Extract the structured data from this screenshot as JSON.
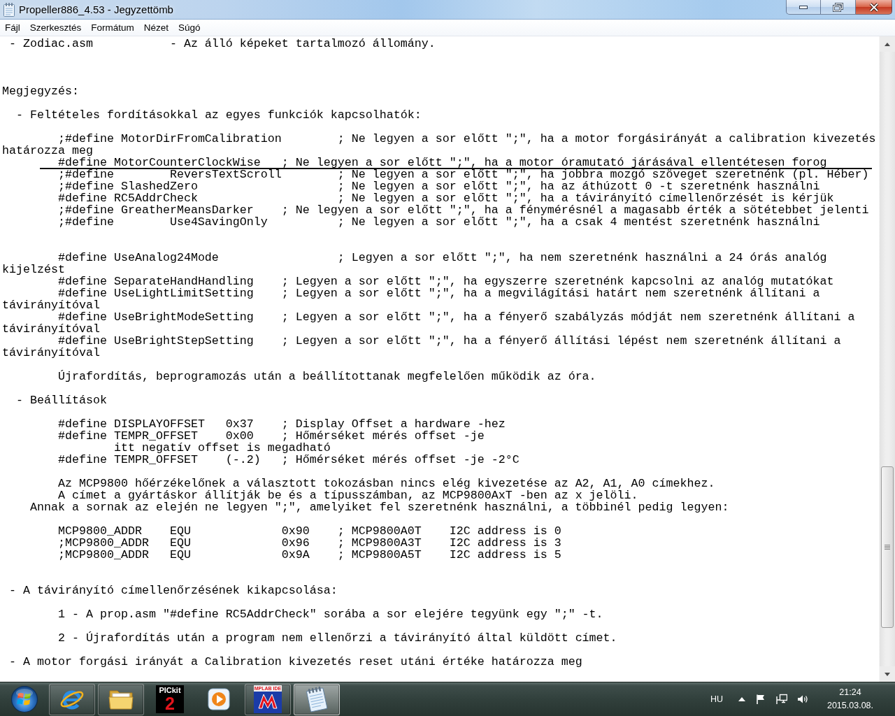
{
  "window": {
    "title": "Propeller886_4.53 - Jegyzettömb"
  },
  "menu": [
    {
      "label": "Fájl"
    },
    {
      "label": "Szerkesztés"
    },
    {
      "label": "Formátum"
    },
    {
      "label": "Nézet"
    },
    {
      "label": "Súgó"
    }
  ],
  "document": {
    "lines": [
      {
        "kind": "text",
        "text": " - Zodiac.asm\t\t- Az álló képeket tartalmozó állomány.",
        "underlined": false
      },
      {
        "kind": "blank"
      },
      {
        "kind": "blank"
      },
      {
        "kind": "blank"
      },
      {
        "kind": "text",
        "text": "Megjegyzés:",
        "underlined": false
      },
      {
        "kind": "blank"
      },
      {
        "kind": "text",
        "text": "  - Feltételes fordításokkal az egyes funkciók kapcsolhatók:",
        "underlined": false
      },
      {
        "kind": "blank"
      },
      {
        "kind": "text",
        "text": "\t;#define MotorDirFromCalibration\t; Ne legyen a sor előtt \";\", ha a motor forgásirányát a calibration kivezetés határozza meg",
        "underlined": false
      },
      {
        "kind": "text",
        "text": "\t#define MotorCounterClockWise\t; Ne legyen a sor előtt \";\", ha a motor óramutató járásával ellentétesen forog",
        "underlined": true
      },
      {
        "kind": "text",
        "text": "\t;#define\tReversTextScroll\t; Ne legyen a sor előtt \";\", ha jobbra mozgó szöveget szeretnénk (pl. Héber)",
        "underlined": false
      },
      {
        "kind": "text",
        "text": "\t;#define SlashedZero\t\t\t; Ne legyen a sor előtt \";\", ha az áthúzott 0 -t szeretnénk használni",
        "underlined": false
      },
      {
        "kind": "text",
        "text": "\t#define RC5AddrCheck\t\t\t; Ne legyen a sor előtt \";\", ha a távirányító címellenőrzését is kérjük",
        "underlined": false
      },
      {
        "kind": "text",
        "text": "\t;#define GreatherMeansDarker\t; Ne legyen a sor előtt \";\", ha a fénymérésnél a magasabb érték a sötétebbet jelenti",
        "underlined": false
      },
      {
        "kind": "text",
        "text": "\t;#define\tUse4SavingOnly\t\t; Ne legyen a sor előtt \";\", ha a csak 4 mentést szeretnénk használni",
        "underlined": false
      },
      {
        "kind": "blank"
      },
      {
        "kind": "blank"
      },
      {
        "kind": "text",
        "text": "\t#define UseAnalog24Mode\t\t\t; Legyen a sor előtt \";\", ha nem szeretnénk használni a 24 órás analóg kijelzést",
        "underlined": false
      },
      {
        "kind": "text",
        "text": "\t#define SeparateHandHandling\t; Legyen a sor előtt \";\", ha egyszerre szeretnénk kapcsolni az analóg mutatókat",
        "underlined": false
      },
      {
        "kind": "text",
        "text": "\t#define UseLightLimitSetting\t; Legyen a sor előtt \";\", ha a megvilágítási határt nem szeretnénk állítani a távirányítóval",
        "underlined": false
      },
      {
        "kind": "text",
        "text": "\t#define UseBrightModeSetting\t; Legyen a sor előtt \";\", ha a fényerő szabályzás módját nem szeretnénk állítani a távirányítóval",
        "underlined": false
      },
      {
        "kind": "text",
        "text": "\t#define UseBrightStepSetting\t; Legyen a sor előtt \";\", ha a fényerő állítási lépést nem szeretnénk állítani a távirányítóval",
        "underlined": false
      },
      {
        "kind": "blank"
      },
      {
        "kind": "text",
        "text": "\tÚjrafordítás, beprogramozás után a beállítottanak megfelelően működik az óra.",
        "underlined": false
      },
      {
        "kind": "blank"
      },
      {
        "kind": "text",
        "text": "  - Beállítások",
        "underlined": false
      },
      {
        "kind": "blank"
      },
      {
        "kind": "text",
        "text": "\t#define DISPLAYOFFSET\t0x37\t; Display Offset a hardware -hez",
        "underlined": false
      },
      {
        "kind": "text",
        "text": "\t#define TEMPR_OFFSET\t0x00\t; Hőmérséket mérés offset -je",
        "underlined": false
      },
      {
        "kind": "text",
        "text": "\t\titt negatív offset is megadható",
        "underlined": false
      },
      {
        "kind": "text",
        "text": "\t#define TEMPR_OFFSET\t(-.2)\t; Hőmérséket mérés offset -je -2°C",
        "underlined": false
      },
      {
        "kind": "blank"
      },
      {
        "kind": "text",
        "text": "\tAz MCP9800 hőérzékelőnek a választott tokozásban nincs elég kivezetése az A2, A1, A0 címekhez.",
        "underlined": false
      },
      {
        "kind": "text",
        "text": "\tA címet a gyártáskor állítják be és a típusszámban, az MCP9800AxT -ben az x jelöli.",
        "underlined": false
      },
      {
        "kind": "text",
        "text": "    Annak a sornak az elején ne legyen \";\", amelyiket fel szeretnénk használni, a többinél pedig legyen:",
        "underlined": false
      },
      {
        "kind": "blank"
      },
      {
        "kind": "text",
        "text": "\tMCP9800_ADDR\tEQU\t\t0x90\t; MCP9800A0T\tI2C address is 0",
        "underlined": false
      },
      {
        "kind": "text",
        "text": "\t;MCP9800_ADDR\tEQU\t\t0x96\t; MCP9800A3T\tI2C address is 3",
        "underlined": false
      },
      {
        "kind": "text",
        "text": "\t;MCP9800_ADDR\tEQU\t\t0x9A\t; MCP9800A5T\tI2C address is 5",
        "underlined": false
      },
      {
        "kind": "blank"
      },
      {
        "kind": "blank"
      },
      {
        "kind": "text",
        "text": " - A távirányító címellenőrzésének kikapcsolása:",
        "underlined": false
      },
      {
        "kind": "blank"
      },
      {
        "kind": "text",
        "text": "\t1 - A prop.asm \"#define RC5AddrCheck\" sorába a sor elejére tegyünk egy \";\" -t.",
        "underlined": false
      },
      {
        "kind": "blank"
      },
      {
        "kind": "text",
        "text": "\t2 - Újrafordítás után a program nem ellenőrzi a távirányító által küldött címet.",
        "underlined": false
      },
      {
        "kind": "blank"
      },
      {
        "kind": "text",
        "text": " - A motor forgási irányát a Calibration kivezetés reset utáni értéke határozza meg",
        "underlined": false
      }
    ]
  },
  "taskbar": {
    "apps": [
      {
        "kind": "browser",
        "running": true,
        "selected": false
      },
      {
        "kind": "folder",
        "running": true,
        "selected": false
      },
      {
        "kind": "pickit",
        "running": false,
        "selected": false,
        "logo_text": "PICkit",
        "logo_number": "2"
      },
      {
        "kind": "media",
        "running": false,
        "selected": false
      },
      {
        "kind": "mplab",
        "running": true,
        "selected": false,
        "logo_text": "MPLAB IDE"
      },
      {
        "kind": "notepad",
        "running": true,
        "selected": true
      }
    ],
    "language": "HU",
    "time": "21:24",
    "date": "2015.03.08."
  }
}
